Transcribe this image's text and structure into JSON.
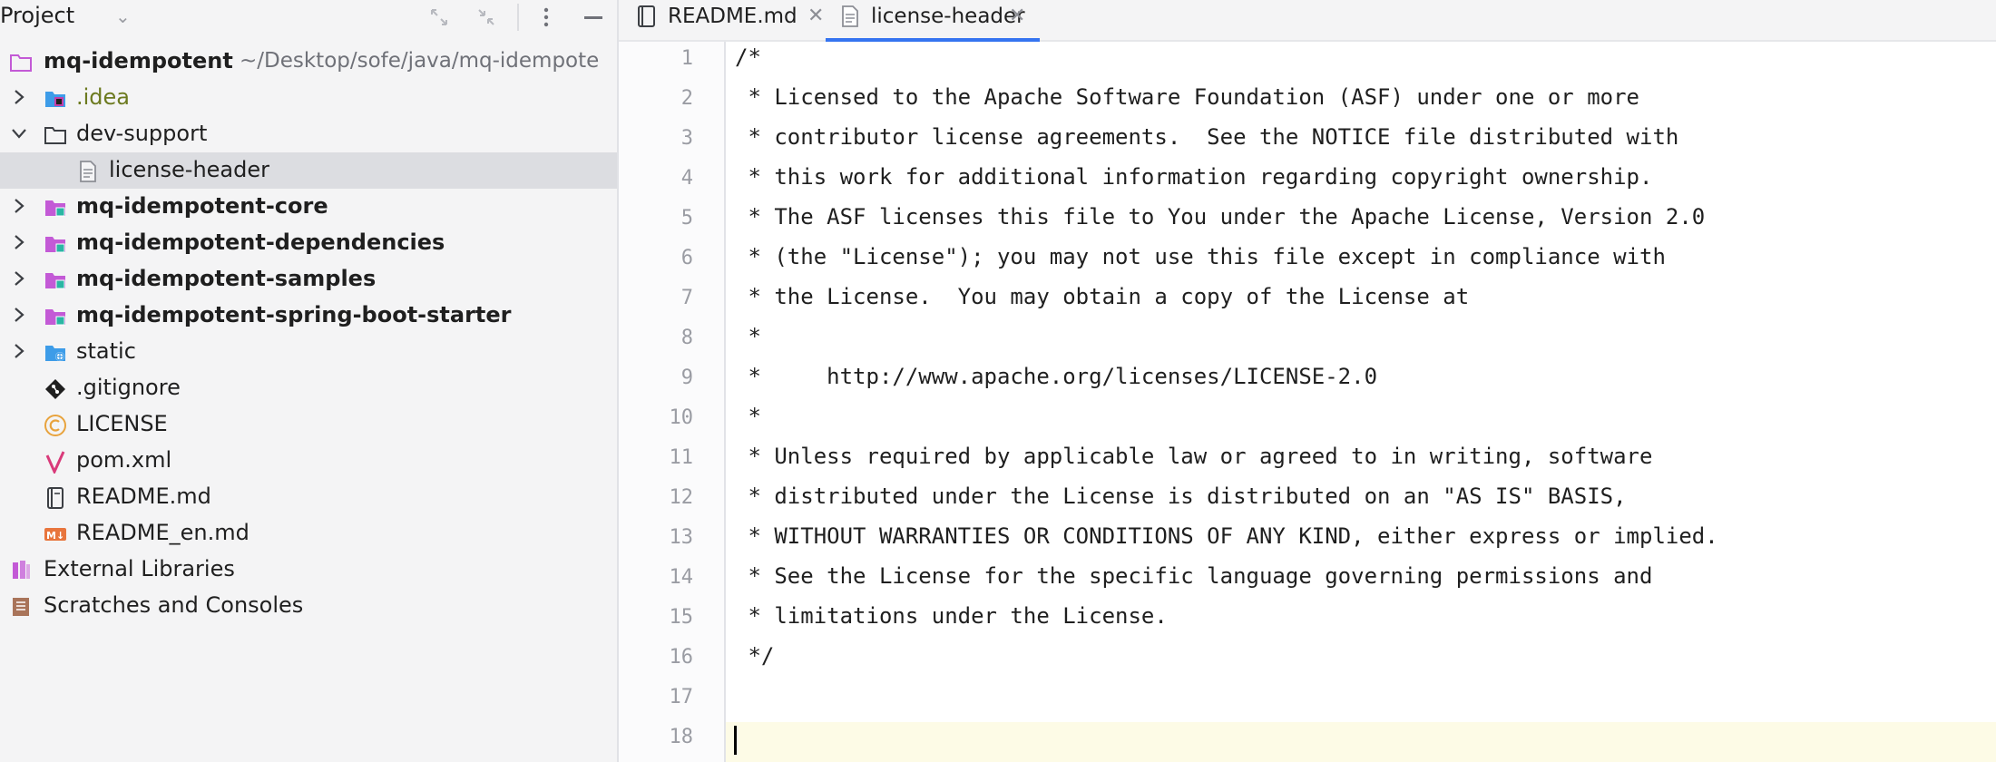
{
  "project_panel": {
    "title": "Project",
    "icons": [
      "chevron-down-icon",
      "expand-all-icon",
      "collapse-all-icon",
      "more-options-icon",
      "minimize-icon"
    ],
    "tree": [
      {
        "name": "mq-idempotent",
        "path": "~/Desktop/sofe/java/mq-idempote",
        "icon": "folder-icon",
        "bold": true
      },
      {
        "name": ".idea",
        "icon": "idea-folder-icon",
        "expandable": true
      },
      {
        "name": "dev-support",
        "icon": "folder-icon",
        "expanded": true
      },
      {
        "name": "license-header",
        "icon": "text-file-icon",
        "selected": true
      },
      {
        "name": "mq-idempotent-core",
        "icon": "module-folder-icon",
        "expandable": true,
        "bold": true
      },
      {
        "name": "mq-idempotent-dependencies",
        "icon": "module-folder-icon",
        "expandable": true,
        "bold": true
      },
      {
        "name": "mq-idempotent-samples",
        "icon": "module-folder-icon",
        "expandable": true,
        "bold": true
      },
      {
        "name": "mq-idempotent-spring-boot-starter",
        "icon": "module-folder-icon",
        "expandable": true,
        "bold": true
      },
      {
        "name": "static",
        "icon": "web-folder-icon",
        "expandable": true
      },
      {
        "name": ".gitignore",
        "icon": "git-icon"
      },
      {
        "name": "LICENSE",
        "icon": "license-icon"
      },
      {
        "name": "pom.xml",
        "icon": "maven-icon"
      },
      {
        "name": "README.md",
        "icon": "markdown-book-icon"
      },
      {
        "name": "README_en.md",
        "icon": "markdown-file-icon"
      },
      {
        "name": "External Libraries",
        "icon": "libraries-icon"
      },
      {
        "name": "Scratches and Consoles",
        "icon": "scratches-icon"
      }
    ]
  },
  "editor": {
    "tabs": [
      {
        "label": "README.md",
        "icon": "markdown-book-icon",
        "active": false
      },
      {
        "label": "license-header",
        "icon": "text-file-icon",
        "active": true
      }
    ],
    "lines": [
      "/*",
      " * Licensed to the Apache Software Foundation (ASF) under one or more",
      " * contributor license agreements.  See the NOTICE file distributed with",
      " * this work for additional information regarding copyright ownership.",
      " * The ASF licenses this file to You under the Apache License, Version 2.0",
      " * (the \"License\"); you may not use this file except in compliance with",
      " * the License.  You may obtain a copy of the License at",
      " *",
      " *     http://www.apache.org/licenses/LICENSE-2.0",
      " *",
      " * Unless required by applicable law or agreed to in writing, software",
      " * distributed under the License is distributed on an \"AS IS\" BASIS,",
      " * WITHOUT WARRANTIES OR CONDITIONS OF ANY KIND, either express or implied.",
      " * See the License for the specific language governing permissions and",
      " * limitations under the License.",
      " */",
      "",
      ""
    ],
    "line_numbers": [
      "1",
      "2",
      "3",
      "4",
      "5",
      "6",
      "7",
      "8",
      "9",
      "10",
      "11",
      "12",
      "13",
      "14",
      "15",
      "16",
      "17",
      "18"
    ],
    "current_line": 18
  },
  "colors": {
    "accent": "#3574f0",
    "module_icon": "#c35ad6",
    "license_icon": "#e8a33d",
    "maven_icon": "#d93a7a"
  }
}
